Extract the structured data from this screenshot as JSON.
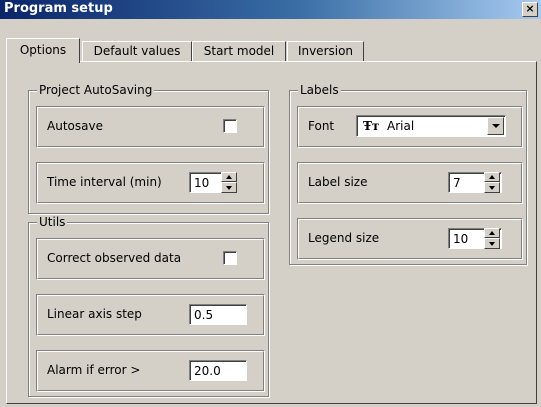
{
  "window": {
    "title": "Program setup",
    "close_label": "×"
  },
  "tabs": [
    {
      "label": "Options"
    },
    {
      "label": "Default values"
    },
    {
      "label": "Start model"
    },
    {
      "label": "Inversion"
    }
  ],
  "autosaving": {
    "title": "Project AutoSaving",
    "autosave_label": "Autosave",
    "autosave_checked": false,
    "interval_label": "Time interval (min)",
    "interval_value": "10"
  },
  "utils": {
    "title": "Utils",
    "correct_label": "Correct observed data",
    "correct_checked": false,
    "step_label": "Linear axis step",
    "step_value": "0.5",
    "alarm_label": "Alarm if error >",
    "alarm_value": "20.0"
  },
  "labels": {
    "title": "Labels",
    "font_label": "Font",
    "font_icon": "truetype-font-icon",
    "font_icon_glyph": "Ŧт",
    "font_value": "Arial",
    "label_size_label": "Label size",
    "label_size_value": "7",
    "legend_size_label": "Legend size",
    "legend_size_value": "10"
  }
}
